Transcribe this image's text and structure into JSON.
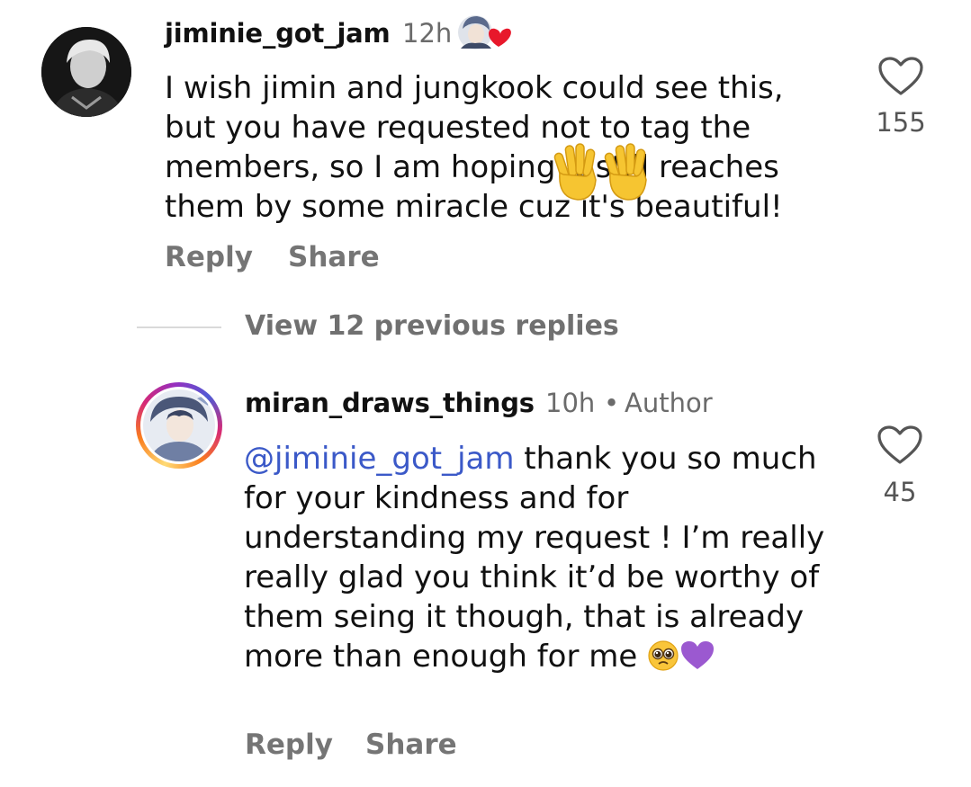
{
  "comments": [
    {
      "username": "jiminie_got_jam",
      "time": "12h",
      "text": "I wish jimin and jungkook could see this, but you have requested not to tag the members, so I am hoping it still reaches them by some miracle cuz it's beautiful!",
      "reply_label": "Reply",
      "share_label": "Share",
      "likes": "155",
      "icons": {
        "avatar": "avatar-photo",
        "sticker": "avatar-with-heart-sticker",
        "like": "heart-outline-icon"
      }
    },
    {
      "username": "miran_draws_things",
      "time": "10h",
      "separator": "•",
      "badge": "Author",
      "mention": "@jiminie_got_jam",
      "text": " thank you so much for your kindness and for understanding my request ! I’m really really glad you think it’d be worthy of them seing it though, that is already more than enough for me",
      "reply_label": "Reply",
      "share_label": "Share",
      "likes": "45",
      "icons": {
        "avatar": "story-ring-avatar",
        "emojis": [
          "pleading-face-emoji",
          "purple-heart-emoji"
        ],
        "like": "heart-outline-icon"
      }
    }
  ],
  "thread": {
    "view_replies_label": "View 12 previous replies"
  },
  "overlay_emojis": [
    "raised-hand-emoji",
    "raised-hand-emoji"
  ],
  "colors": {
    "mention": "#3b59c8",
    "secondary_text": "#757575",
    "heart_purple": "#9b59d0",
    "story_ring": "#d62976"
  }
}
